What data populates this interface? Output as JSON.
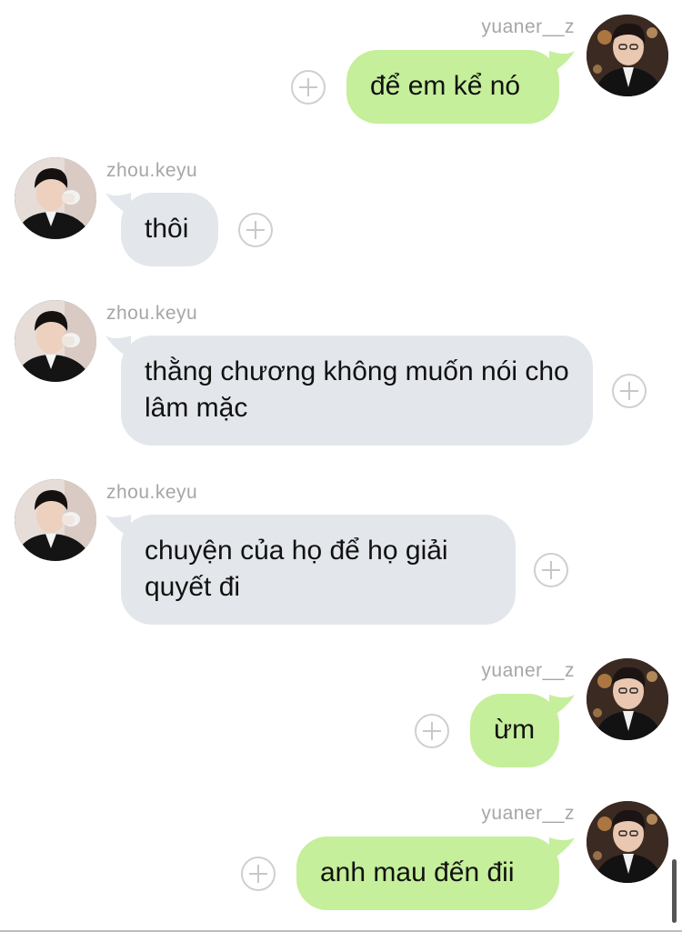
{
  "colors": {
    "outgoing_bubble": "#c5ef9a",
    "incoming_bubble": "#e3e7eb",
    "username": "#a6a6a6",
    "plus_icon": "#c8c8c8"
  },
  "messages": [
    {
      "direction": "outgoing",
      "sender": "yuaner__z",
      "text": "để em kể nó",
      "avatar": "avatar-photo"
    },
    {
      "direction": "incoming",
      "sender": "zhou.keyu",
      "text": "thôi",
      "avatar": "avatar-photo"
    },
    {
      "direction": "incoming",
      "sender": "zhou.keyu",
      "text": "thằng chương không muốn nói cho lâm mặc",
      "avatar": "avatar-photo"
    },
    {
      "direction": "incoming",
      "sender": "zhou.keyu",
      "text": "chuyện của họ để họ giải quyết đi",
      "avatar": "avatar-photo"
    },
    {
      "direction": "outgoing",
      "sender": "yuaner__z",
      "text": "ừm",
      "avatar": "avatar-photo"
    },
    {
      "direction": "outgoing",
      "sender": "yuaner__z",
      "text": "anh mau đến đii",
      "avatar": "avatar-photo"
    }
  ]
}
